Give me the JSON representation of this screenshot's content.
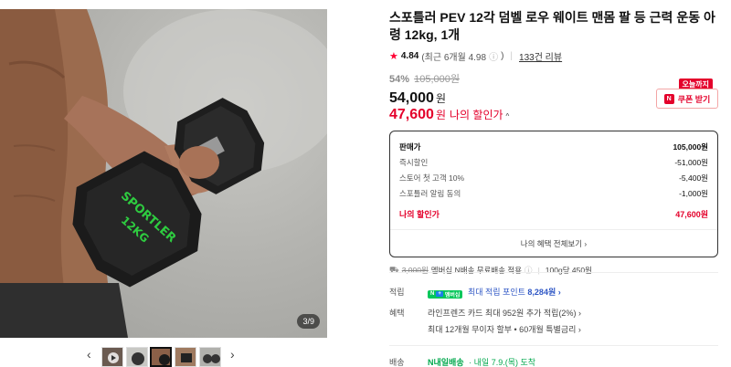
{
  "gallery": {
    "page_indicator": "3/9",
    "prev_arrow": "‹",
    "next_arrow": "›",
    "dumbbell_text_1": "SPORTLER",
    "dumbbell_text_2": "12KG"
  },
  "product": {
    "title": "스포틀러 PEV 12각 덤벨 로우 웨이트 맨몸 팔 등 근력 운동 아령 12kg, 1개",
    "rating": "4.84",
    "rating_recent": "(최근 6개월 4.98",
    "rating_info_icon": "ⓘ",
    "rating_recent_close": ")",
    "review_count": "133건 리뷰",
    "discount_rate": "54%",
    "original_price": "105,000원",
    "price": "54,000",
    "price_unit": "원",
    "my_price": "47,600",
    "my_price_unit": "원",
    "my_price_label": "나의 할인가",
    "my_price_caret": "^"
  },
  "coupon": {
    "badge": "오늘까지",
    "icon": "N",
    "label": "쿠폰 받기"
  },
  "breakdown": {
    "rows": [
      {
        "label": "판매가",
        "value": "105,000원"
      },
      {
        "label": "즉시할인",
        "value": "-51,000원"
      },
      {
        "label": "스토어 첫 고객 10%",
        "value": "-5,400원"
      },
      {
        "label": "스포틀러 알림 동의",
        "value": "-1,000원"
      }
    ],
    "my_label": "나의 할인가",
    "my_value": "47,600원",
    "all_benefits_link": "나의 혜택 전체보기 ›"
  },
  "shipping": {
    "old_fee": "3,000원",
    "membership_text": "멤버십 N배송 무료배송 적용",
    "info_icon": "ⓘ",
    "per_weight": "100g당 450원"
  },
  "points": {
    "label": "적립",
    "badge_n": "N",
    "badge_plus": "+",
    "badge_text": "멤버십",
    "text": "최대 적립 포인트",
    "amount": "8,284원 ›"
  },
  "benefits": {
    "label": "혜택",
    "line1": "라인프렌즈 카드 최대 952원 추가 적립(2%) ›",
    "line2": "최대 12개월 무이자 할부 • 60개월 특별금리 ›"
  },
  "delivery": {
    "label": "배송",
    "badge": "N내일배송",
    "date": "· 내일 7.9.(목) 도착"
  },
  "colors": {
    "accent_red": "#e4002b",
    "naver_green": "#03c75a",
    "link_blue": "#2f57c5"
  }
}
